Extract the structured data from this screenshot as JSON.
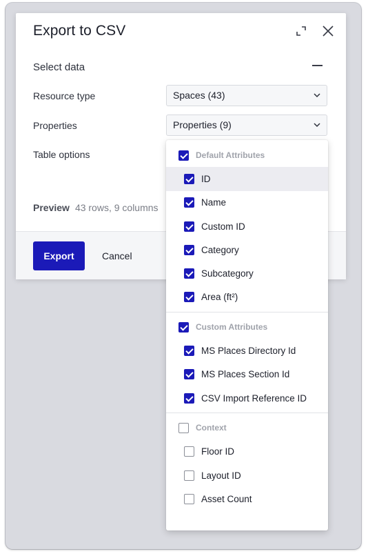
{
  "dialog": {
    "title": "Export to CSV",
    "section_title": "Select data",
    "fields": {
      "resource_type": {
        "label": "Resource type",
        "value": "Spaces (43)"
      },
      "properties": {
        "label": "Properties",
        "value": "Properties (9)"
      },
      "table_options": {
        "label": "Table options"
      }
    },
    "preview": {
      "label": "Preview",
      "value": "43 rows, 9 columns"
    },
    "footer": {
      "export_label": "Export",
      "cancel_label": "Cancel"
    }
  },
  "icons": {
    "expand": "expand-icon",
    "close": "close-icon",
    "collapse": "minus-icon",
    "dropdown": "chevron-down-icon"
  },
  "colors": {
    "accent": "#1b1ab8",
    "backdrop": "#d9dae0",
    "menu_hover": "#ececf1"
  },
  "properties_menu": {
    "groups": [
      {
        "label": "Default Attributes",
        "checked": true,
        "items": [
          {
            "label": "ID",
            "checked": true,
            "hover": true
          },
          {
            "label": "Name",
            "checked": true
          },
          {
            "label": "Custom ID",
            "checked": true
          },
          {
            "label": "Category",
            "checked": true
          },
          {
            "label": "Subcategory",
            "checked": true
          },
          {
            "label": "Area (ft²)",
            "checked": true
          }
        ]
      },
      {
        "label": "Custom Attributes",
        "checked": true,
        "items": [
          {
            "label": "MS Places Directory Id",
            "checked": true
          },
          {
            "label": "MS Places Section Id",
            "checked": true
          },
          {
            "label": "CSV Import Reference ID",
            "checked": true
          }
        ]
      },
      {
        "label": "Context",
        "checked": false,
        "items": [
          {
            "label": "Floor ID",
            "checked": false
          },
          {
            "label": "Layout ID",
            "checked": false
          },
          {
            "label": "Asset Count",
            "checked": false
          }
        ]
      }
    ]
  }
}
